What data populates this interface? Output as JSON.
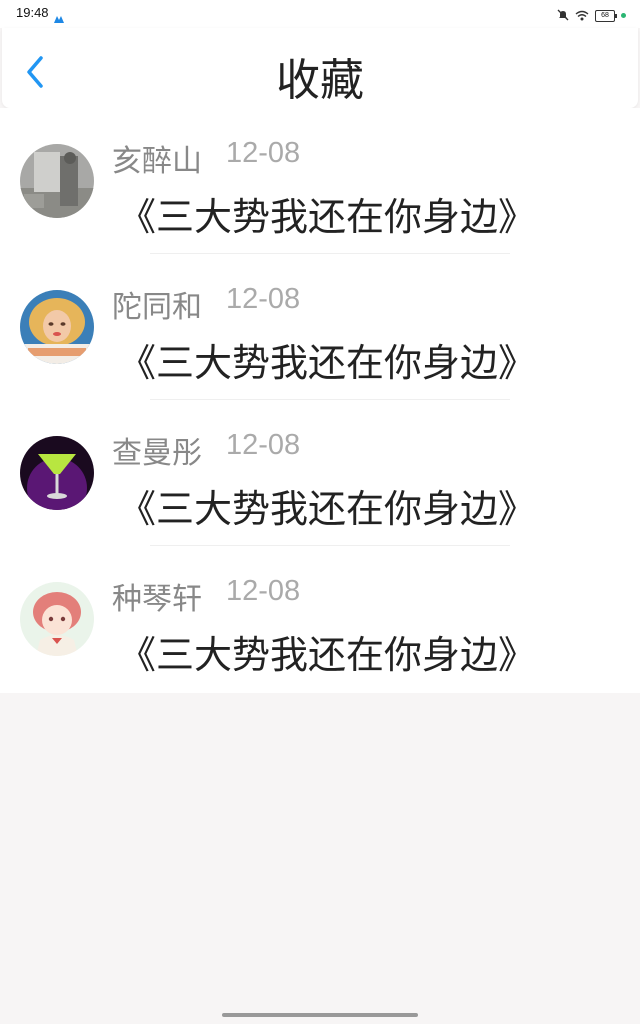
{
  "status_bar": {
    "time": "19:48",
    "battery": "68"
  },
  "header": {
    "title": "收藏",
    "back_icon": "chevron-left-icon",
    "accent_color": "#2196f3"
  },
  "favorites": [
    {
      "name": "亥醉山",
      "date": "12-08",
      "text": "《三大势我还在你身边》",
      "avatar": "photo-avatar"
    },
    {
      "name": "陀同和",
      "date": "12-08",
      "text": "《三大势我还在你身边》",
      "avatar": "photo-avatar"
    },
    {
      "name": "查曼彤",
      "date": "12-08",
      "text": "《三大势我还在你身边》",
      "avatar": "photo-avatar"
    },
    {
      "name": "种琴轩",
      "date": "12-08",
      "text": "《三大势我还在你身边》",
      "avatar": "anime-avatar"
    }
  ]
}
